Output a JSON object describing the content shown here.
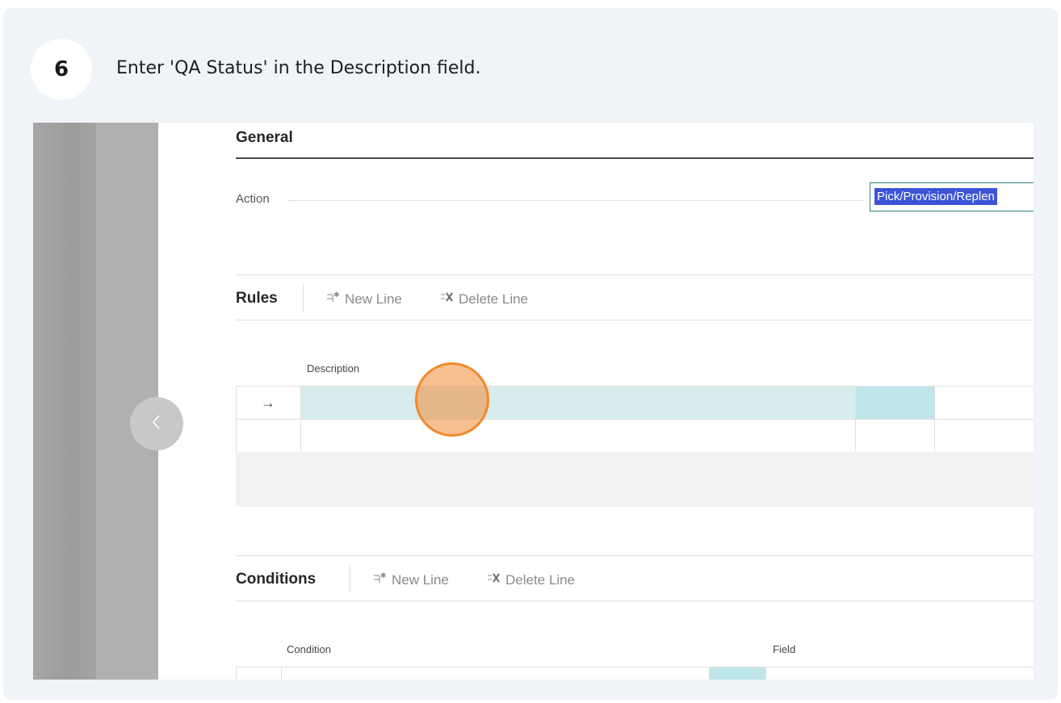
{
  "step": {
    "number": "6",
    "instruction": "Enter 'QA Status' in the Description field."
  },
  "general": {
    "title": "General",
    "action_label": "Action",
    "action_value": "Pick/Provision/Replen"
  },
  "rules": {
    "title": "Rules",
    "new_line": "New Line",
    "delete_line": "Delete Line",
    "col_description": "Description",
    "row_arrow": "→"
  },
  "conditions": {
    "title": "Conditions",
    "new_line": "New Line",
    "delete_line": "Delete Line",
    "col_condition": "Condition",
    "col_field": "Field",
    "row_arrow": "→"
  },
  "colors": {
    "selected_row": "#d8ecee",
    "selected_cell": "#bfe6ea",
    "highlight": "#3c55d6",
    "click_marker": "#f08a2c"
  },
  "icons": {
    "side_nav": "chevron-left-icon",
    "new_line": "new-line-icon",
    "delete_line": "delete-line-icon"
  }
}
